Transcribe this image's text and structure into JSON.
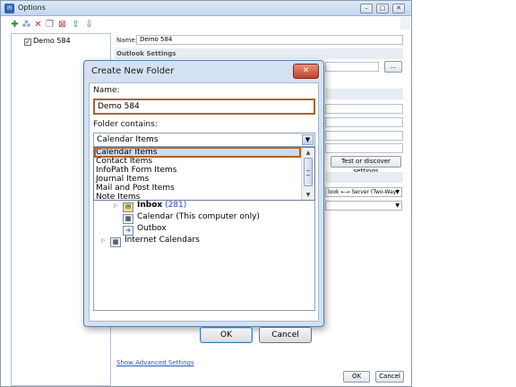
{
  "options_window": {
    "title": "Options",
    "toolbar_icons": [
      "new-icon",
      "add-icon",
      "delete-icon",
      "copy-icon",
      "remove-icon",
      "export-icon",
      "import-icon"
    ],
    "tree": {
      "item_label": "Demo 584",
      "checked": true
    },
    "name_label": "Name:",
    "name_value": "Demo 584",
    "section_title": "Outlook Settings",
    "browse_button": "...",
    "test_button": "Test or discover settings",
    "sync_select_value": "look ←→ Server (Two-Way)",
    "show_advanced_link": "Show Advanced Settings",
    "ok_button": "OK",
    "cancel_button": "Cancel"
  },
  "dialog": {
    "title": "Create New Folder",
    "close_glyph": "✕",
    "name_label": "Name:",
    "name_value": "Demo 584",
    "folder_contains_label": "Folder contains:",
    "combo_value": "Calendar Items",
    "list_items": [
      "Calendar Items",
      "Contact Items",
      "InfoPath Form Items",
      "Journal Items",
      "Mail and Post Items",
      "Note Items"
    ],
    "selected_index": 0,
    "tree": [
      {
        "label": "Inbox",
        "count": "(281)",
        "bold": true,
        "icon": "inbox-icon",
        "expander": true
      },
      {
        "label": "Calendar (This computer only)",
        "icon": "calendar-icon",
        "expander": false
      },
      {
        "label": "Outbox",
        "icon": "outbox-icon",
        "expander": false
      },
      {
        "label": "Internet Calendars",
        "icon": "internet-calendar-icon",
        "expander": true
      }
    ],
    "ok_button": "OK",
    "cancel_button": "Cancel"
  }
}
